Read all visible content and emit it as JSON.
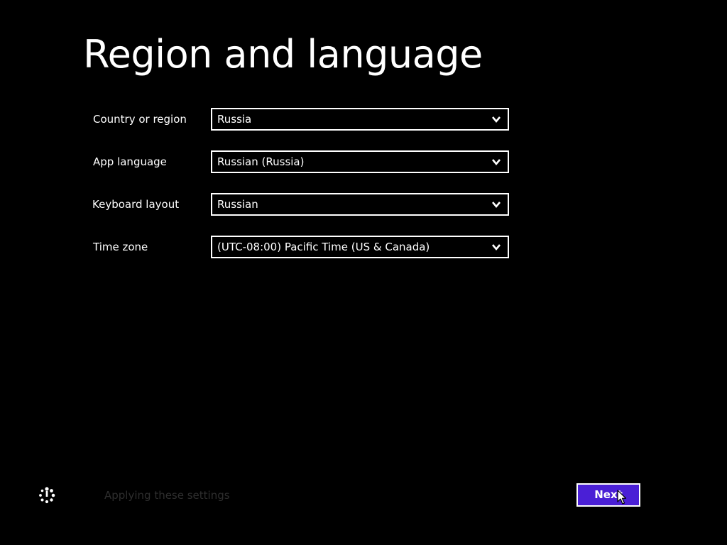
{
  "page": {
    "title": "Region and language"
  },
  "form": {
    "fields": [
      {
        "label": "Country or region",
        "value": "Russia"
      },
      {
        "label": "App language",
        "value": "Russian (Russia)"
      },
      {
        "label": "Keyboard layout",
        "value": "Russian"
      },
      {
        "label": "Time zone",
        "value": "(UTC-08:00) Pacific Time (US & Canada)"
      }
    ]
  },
  "status": {
    "text": "Applying these settings",
    "icon": "spinner-icon"
  },
  "footer": {
    "next_label": "Next"
  },
  "colors": {
    "background": "#000000",
    "foreground": "#ffffff",
    "accent": "#4a1fd6",
    "status_text": "#2e2e2e"
  }
}
